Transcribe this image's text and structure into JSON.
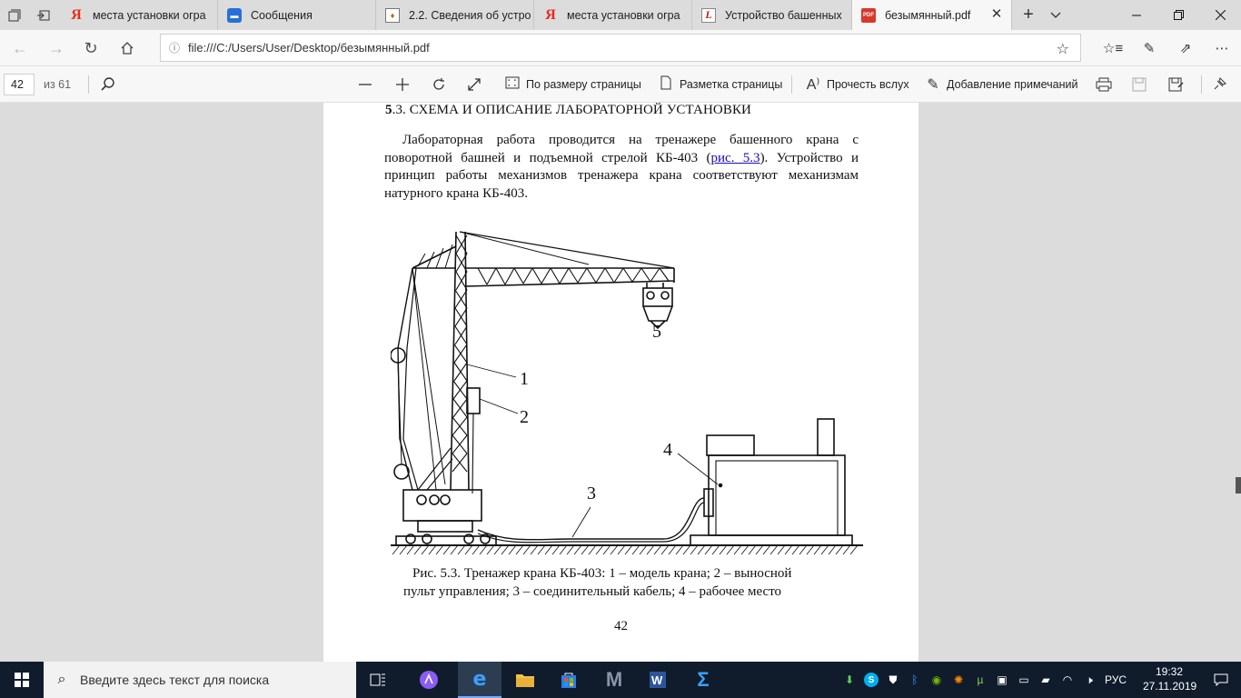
{
  "tabs": [
    {
      "label": "места установки огра",
      "favicon": "yandex-icon",
      "active": false
    },
    {
      "label": "Сообщения",
      "favicon": "messages-icon",
      "active": false
    },
    {
      "label": "2.2. Сведения об устро",
      "favicon": "document-icon",
      "active": false
    },
    {
      "label": "места установки огра",
      "favicon": "yandex-icon",
      "active": false
    },
    {
      "label": "Устройство башенных",
      "favicon": "site-l-icon",
      "active": false
    },
    {
      "label": "безымянный.pdf",
      "favicon": "pdf-icon",
      "active": true
    }
  ],
  "address": {
    "url": "file:///C:/Users/User/Desktop/безымянный.pdf"
  },
  "pdf_toolbar": {
    "page_current": "42",
    "page_total": "из 61",
    "fit_page": "По размеру страницы",
    "page_layout": "Разметка страницы",
    "read_aloud": "Прочесть вслух",
    "add_notes": "Добавление примечаний"
  },
  "document": {
    "heading_num": "5",
    "heading_rest": ".3. СХЕМА И ОПИСАНИЕ ЛАБОРАТОРНОЙ УСТАНОВКИ",
    "para_before_link": "Лабораторная работа проводится на тренажере башенного крана с поворотной башней и подъемной стрелой КБ-403 (",
    "para_link": "рис. 5.3",
    "para_after_link": "). Устрой­ство и принцип работы механизмов тренажера крана соответствуют механизмам натурного крана КБ-403.",
    "figure_labels": [
      "1",
      "2",
      "3",
      "4",
      "5"
    ],
    "caption_line1": "Рис. 5.3. Тренажер крана КБ-403: 1 – модель крана; 2 – выносной",
    "caption_line2": "пульт управления; 3 – соединительный кабель; 4 – рабочее место",
    "page_number": "42"
  },
  "taskbar": {
    "search_placeholder": "Введите здесь текст для поиска",
    "language": "РУС",
    "time": "19:32",
    "date": "27.11.2019"
  },
  "colors": {
    "tabbar_bg": "#dcdcdc",
    "active_tab_bg": "#f7f7f7",
    "viewer_bg": "#dcdcdc",
    "taskbar_bg": "#101c2c",
    "link": "#1a0dab"
  }
}
